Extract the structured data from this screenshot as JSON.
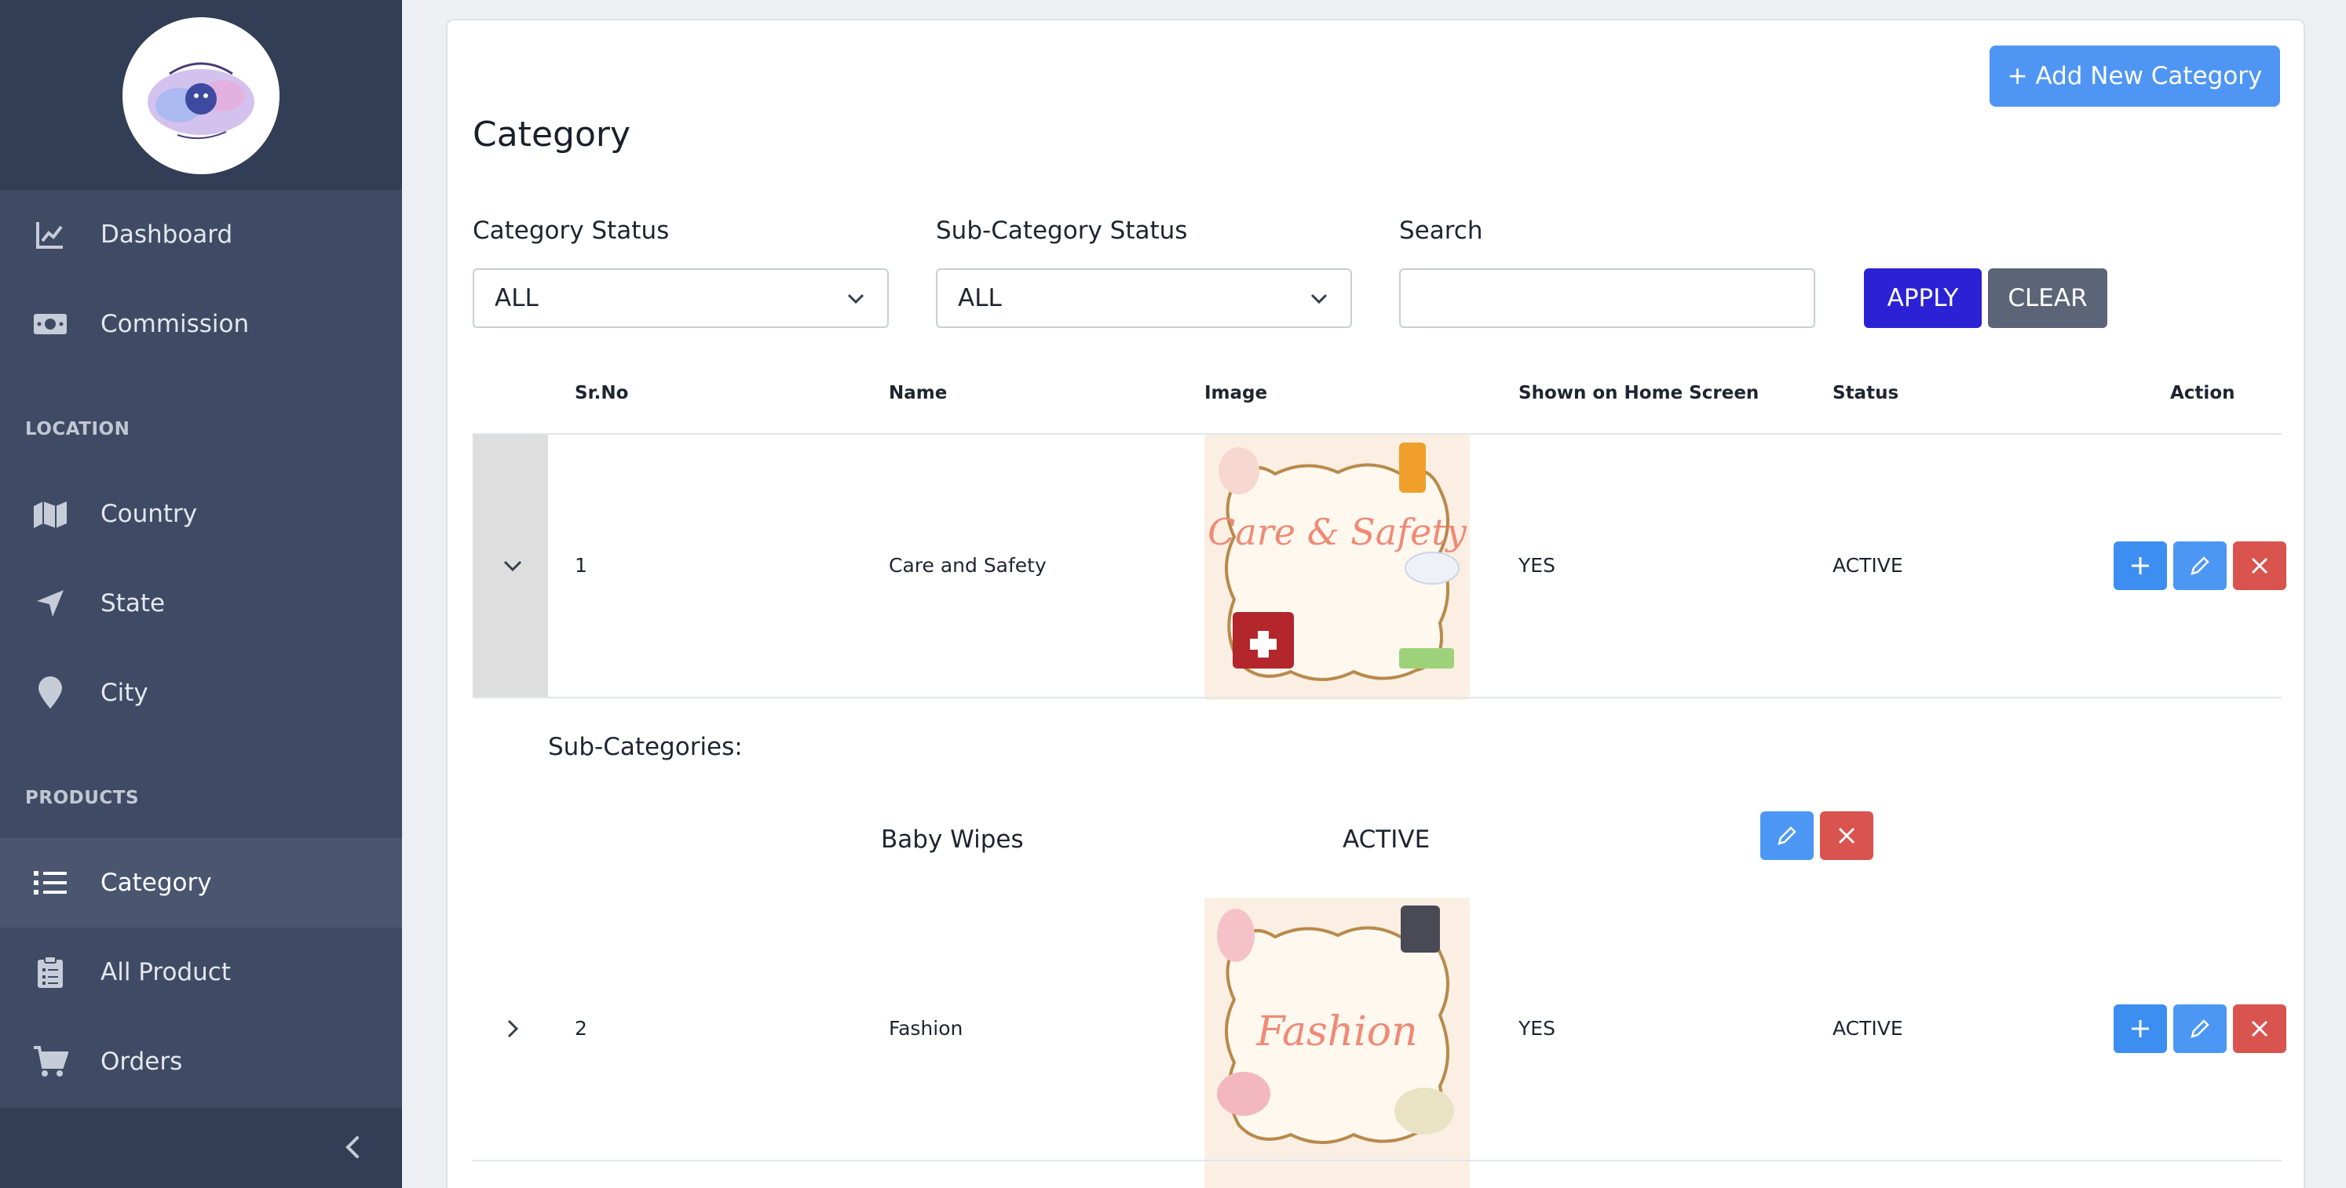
{
  "sidebar": {
    "items": {
      "dashboard": "Dashboard",
      "commission": "Commission",
      "country": "Country",
      "state": "State",
      "city": "City",
      "category": "Category",
      "all_product": "All Product",
      "orders": "Orders"
    },
    "sections": {
      "location": "LOCATION",
      "products": "PRODUCTS"
    },
    "active_item": "category"
  },
  "header": {
    "add_button_label": "+ Add New Category",
    "page_title": "Category"
  },
  "filters": {
    "category_status_label": "Category Status",
    "category_status_value": "ALL",
    "sub_category_status_label": "Sub-Category Status",
    "sub_category_status_value": "ALL",
    "search_label": "Search",
    "search_value": "",
    "apply_label": "APPLY",
    "clear_label": "CLEAR"
  },
  "table": {
    "columns": [
      "Sr.No",
      "Name",
      "Image",
      "Shown on Home Screen",
      "Status",
      "Action"
    ],
    "rows": [
      {
        "sr_no": "1",
        "name": "Care and Safety",
        "image_label": "Care & Safety",
        "shown_on_home": "YES",
        "status": "ACTIVE",
        "expanded": true
      },
      {
        "sr_no": "2",
        "name": "Fashion",
        "image_label": "Fashion",
        "shown_on_home": "YES",
        "status": "ACTIVE",
        "expanded": false
      }
    ],
    "sub_categories_title": "Sub-Categories:",
    "sub_categories": [
      {
        "name": "Baby Wipes",
        "status": "ACTIVE"
      }
    ]
  },
  "colors": {
    "sidebar_bg": "#3f4b64",
    "sidebar_header_bg": "#323e55",
    "primary": "#4f96f4",
    "apply": "#2b22d6",
    "clear": "#5b6577",
    "danger": "#d9534f"
  }
}
